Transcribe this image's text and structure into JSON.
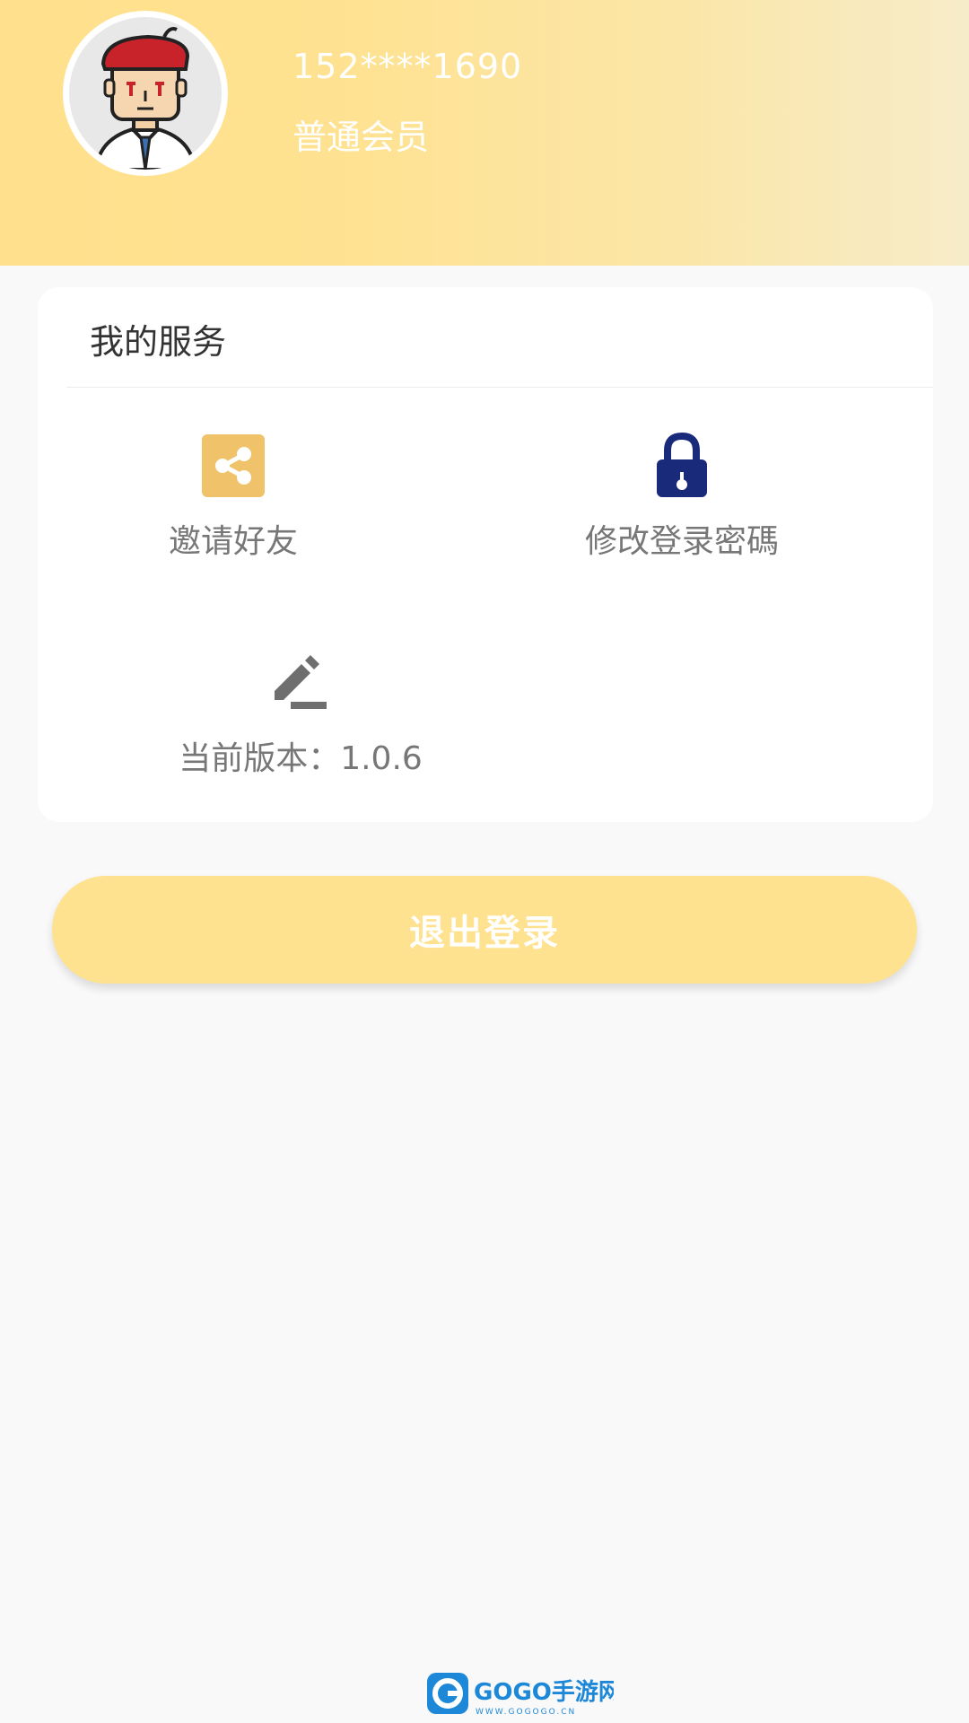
{
  "profile": {
    "phone": "152****1690",
    "level": "普通会员"
  },
  "services": {
    "title": "我的服务",
    "items": [
      {
        "label": "邀请好友",
        "icon": "share-icon"
      },
      {
        "label": "修改登录密碼",
        "icon": "lock-icon"
      },
      {
        "label": "当前版本：1.0.6",
        "icon": "edit-icon"
      }
    ]
  },
  "logout": {
    "label": "退出登录"
  },
  "watermark": {
    "brand": "GOGO手游网",
    "url": "WWW.GOGOGO.CN"
  },
  "colors": {
    "header": "#ffe08c",
    "accent": "#f0c36a",
    "lock": "#1a2a7a",
    "logout_button": "#ffe28f"
  }
}
